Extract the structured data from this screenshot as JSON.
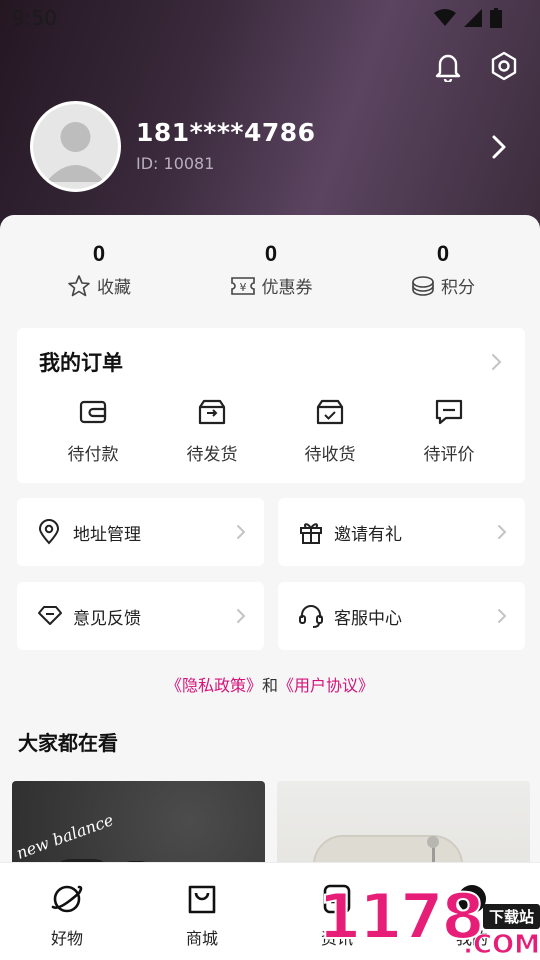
{
  "status_bar": {
    "time": "9:50"
  },
  "profile": {
    "username": "181****4786",
    "user_id": "ID: 10081"
  },
  "stats": [
    {
      "value": "0",
      "label": "收藏",
      "icon": "star-icon"
    },
    {
      "value": "0",
      "label": "优惠券",
      "icon": "coupon-icon"
    },
    {
      "value": "0",
      "label": "积分",
      "icon": "points-icon"
    }
  ],
  "orders": {
    "title": "我的订单",
    "items": [
      {
        "label": "待付款",
        "icon": "wallet-icon"
      },
      {
        "label": "待发货",
        "icon": "ship-box-icon"
      },
      {
        "label": "待收货",
        "icon": "receive-box-icon"
      },
      {
        "label": "待评价",
        "icon": "comment-icon"
      }
    ]
  },
  "services": [
    {
      "label": "地址管理",
      "icon": "location-icon"
    },
    {
      "label": "邀请有礼",
      "icon": "gift-icon"
    },
    {
      "label": "意见反馈",
      "icon": "feedback-icon"
    },
    {
      "label": "客服中心",
      "icon": "headset-icon"
    }
  ],
  "policy": {
    "privacy": "《隐私政策》",
    "and": "和",
    "agreement": "《用户协议》"
  },
  "recommend": {
    "title": "大家都在看",
    "brand_text": "new balance"
  },
  "tabs": [
    {
      "label": "好物",
      "icon": "planet-icon"
    },
    {
      "label": "商城",
      "icon": "bag-icon"
    },
    {
      "label": "资讯",
      "icon": "news-icon"
    },
    {
      "label": "我的",
      "icon": "profile-icon"
    }
  ],
  "watermark": {
    "digits": "1178",
    "tag": "下载站",
    "suffix": ".COM"
  },
  "colors": {
    "accent": "#d4147a",
    "header": "#3a2a3c"
  }
}
